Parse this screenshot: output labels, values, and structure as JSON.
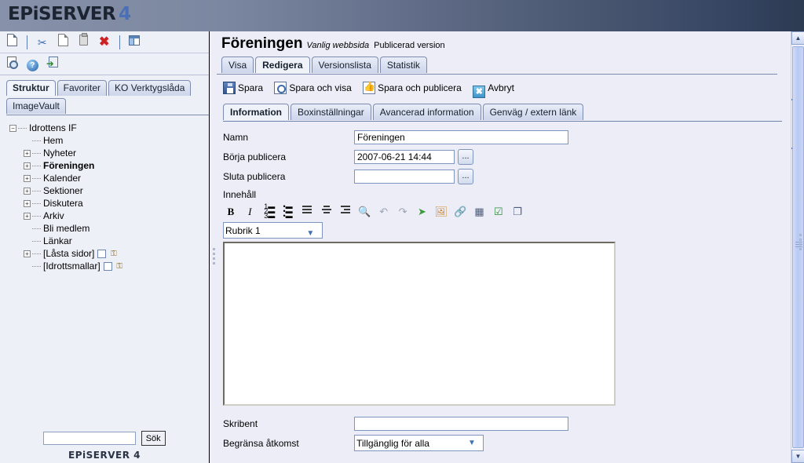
{
  "header": {
    "logo_main": "EPiSERVER",
    "logo_accent": "4",
    "accent_color": "#4a6fb5"
  },
  "left_toolbar": {
    "row1": [
      {
        "name": "new-page-icon",
        "title": "Ny sida"
      },
      {
        "name": "cut-icon",
        "title": "Klipp ut"
      },
      {
        "name": "copy-icon",
        "title": "Kopiera"
      },
      {
        "name": "paste-icon",
        "title": "Klistra in"
      },
      {
        "name": "delete-icon",
        "title": "Ta bort",
        "glyph": "✖"
      },
      {
        "name": "toggle-panel-icon",
        "title": "Visa/dölj panel"
      }
    ],
    "row2": [
      {
        "name": "preview-icon",
        "title": "Förhandsgranska"
      },
      {
        "name": "help-icon",
        "title": "Hjälp",
        "glyph": "?"
      },
      {
        "name": "logout-icon",
        "title": "Logga ut"
      }
    ]
  },
  "sidebar": {
    "tabs_row1": [
      {
        "label": "Struktur",
        "active": true
      },
      {
        "label": "Favoriter",
        "active": false
      },
      {
        "label": "KO Verktygslåda",
        "active": false
      }
    ],
    "tabs_row2": [
      {
        "label": "ImageVault",
        "active": false
      }
    ],
    "tree": [
      {
        "label": "Idrottens IF",
        "depth": 0,
        "toggle": "minus",
        "bold": false,
        "icons": []
      },
      {
        "label": "Hem",
        "depth": 1,
        "toggle": "none",
        "bold": false,
        "icons": []
      },
      {
        "label": "Nyheter",
        "depth": 1,
        "toggle": "plus",
        "bold": false,
        "icons": []
      },
      {
        "label": "Föreningen",
        "depth": 1,
        "toggle": "plus",
        "bold": true,
        "icons": []
      },
      {
        "label": "Kalender",
        "depth": 1,
        "toggle": "plus",
        "bold": false,
        "icons": []
      },
      {
        "label": "Sektioner",
        "depth": 1,
        "toggle": "plus",
        "bold": false,
        "icons": []
      },
      {
        "label": "Diskutera",
        "depth": 1,
        "toggle": "plus",
        "bold": false,
        "icons": []
      },
      {
        "label": "Arkiv",
        "depth": 1,
        "toggle": "plus",
        "bold": false,
        "icons": []
      },
      {
        "label": "Bli medlem",
        "depth": 1,
        "toggle": "none",
        "bold": false,
        "icons": []
      },
      {
        "label": "Länkar",
        "depth": 1,
        "toggle": "none",
        "bold": false,
        "icons": []
      },
      {
        "label": "[Låsta sidor]",
        "depth": 1,
        "toggle": "plus",
        "bold": false,
        "icons": [
          "doc-icon",
          "lock-icon"
        ]
      },
      {
        "label": "[Idrottsmallar]",
        "depth": 1,
        "toggle": "none",
        "bold": false,
        "icons": [
          "doc-icon",
          "lock-icon"
        ]
      }
    ],
    "search": {
      "value": "",
      "placeholder": "",
      "button_label": "Sök"
    },
    "footer": "EPiSERVER 4"
  },
  "page": {
    "title": "Föreningen",
    "page_type": "Vanlig webbsida",
    "version_status": "Publicerad version",
    "tabs": [
      {
        "label": "Visa",
        "active": false
      },
      {
        "label": "Redigera",
        "active": true
      },
      {
        "label": "Versionslista",
        "active": false
      },
      {
        "label": "Statistik",
        "active": false
      }
    ],
    "actions": [
      {
        "label": "Spara",
        "icon": "save-icon"
      },
      {
        "label": "Spara och visa",
        "icon": "save-preview-icon"
      },
      {
        "label": "Spara och publicera",
        "icon": "save-publish-icon"
      },
      {
        "label": "Avbryt",
        "icon": "cancel-icon"
      }
    ],
    "subtabs": [
      {
        "label": "Information",
        "active": true
      },
      {
        "label": "Boxinställningar",
        "active": false
      },
      {
        "label": "Avancerad information",
        "active": false
      },
      {
        "label": "Genväg / extern länk",
        "active": false
      }
    ],
    "form": {
      "namn_label": "Namn",
      "namn_value": "Föreningen",
      "borja_label": "Börja publicera",
      "borja_value": "2007-06-21 14:44",
      "sluta_label": "Sluta publicera",
      "sluta_value": "",
      "ellipsis_label": "...",
      "innehall_label": "Innehåll",
      "skribent_label": "Skribent",
      "skribent_value": "",
      "access_label": "Begränsa åtkomst",
      "access_value": "Tillgänglig för alla"
    },
    "editor": {
      "style_value": "Rubrik 1",
      "body_value": "",
      "toolbar": [
        {
          "name": "bold-icon",
          "label": "B"
        },
        {
          "name": "italic-icon",
          "label": "I"
        },
        {
          "name": "numbered-list-icon",
          "label": ""
        },
        {
          "name": "bullet-list-icon",
          "label": ""
        },
        {
          "name": "align-left-icon",
          "label": ""
        },
        {
          "name": "align-center-icon",
          "label": ""
        },
        {
          "name": "align-right-icon",
          "label": ""
        },
        {
          "name": "find-icon",
          "label": ""
        },
        {
          "name": "undo-icon",
          "label": ""
        },
        {
          "name": "redo-icon",
          "label": ""
        },
        {
          "name": "insert-page-link-icon",
          "label": ""
        },
        {
          "name": "insert-image-icon",
          "label": ""
        },
        {
          "name": "insert-link-icon",
          "label": ""
        },
        {
          "name": "insert-table-icon",
          "label": ""
        },
        {
          "name": "insert-form-icon",
          "label": ""
        },
        {
          "name": "insert-window-icon",
          "label": ""
        }
      ]
    }
  },
  "scrollbar": {
    "up_label": "▲",
    "down_label": "▼"
  }
}
